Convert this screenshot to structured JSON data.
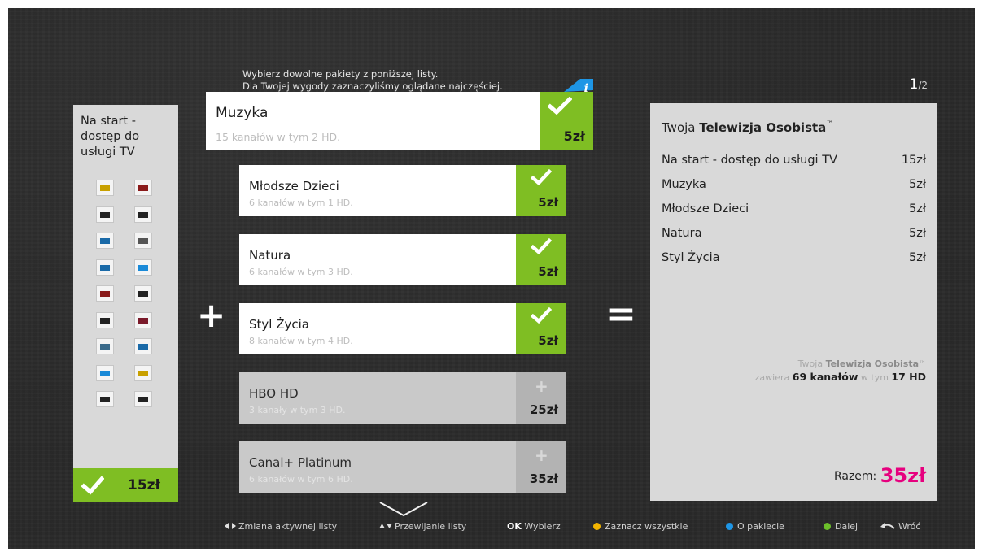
{
  "header": {
    "intro_line1": "Wybierz dowolne pakiety z poniższej listy.",
    "intro_line2": "Dla Twojej wygody zaznaczyliśmy oglądane najczęściej.",
    "page_current": "1",
    "page_total": "/2"
  },
  "base": {
    "title": "Na start - dostęp do usługi TV",
    "price": "15zł",
    "channel_logos": [
      {
        "color": "#c8a000"
      },
      {
        "color": "#8a1a1a"
      },
      {
        "color": "#222222"
      },
      {
        "color": "#222222"
      },
      {
        "color": "#1a6aa8"
      },
      {
        "color": "#555555"
      },
      {
        "color": "#1a6aa8"
      },
      {
        "color": "#1a8ad8"
      },
      {
        "color": "#8a1a1a"
      },
      {
        "color": "#222222"
      },
      {
        "color": "#222222"
      },
      {
        "color": "#7a1a2a"
      },
      {
        "color": "#3a6a8a"
      },
      {
        "color": "#1a6aa8"
      },
      {
        "color": "#1a8ad8"
      },
      {
        "color": "#c8a000"
      },
      {
        "color": "#222222"
      },
      {
        "color": "#222222"
      }
    ]
  },
  "packages": [
    {
      "name": "Muzyka",
      "sub": "15 kanałów w tym 2 HD.",
      "price": "5zł",
      "selected": true
    },
    {
      "name": "Młodsze Dzieci",
      "sub": "6 kanałów w tym 1 HD.",
      "price": "5zł",
      "selected": true
    },
    {
      "name": "Natura",
      "sub": "6 kanałów w tym 3 HD.",
      "price": "5zł",
      "selected": true
    },
    {
      "name": "Styl Życia",
      "sub": "8 kanałów w tym 4 HD.",
      "price": "5zł",
      "selected": true
    },
    {
      "name": "HBO HD",
      "sub": "3 kanały w tym 3 HD.",
      "price": "25zł",
      "selected": false
    },
    {
      "name": "Canal+ Platinum",
      "sub": "6 kanałów w tym 6 HD.",
      "price": "35zł",
      "selected": false
    }
  ],
  "summary": {
    "title_prefix": "Twoja ",
    "title_bold": "Telewizja Osobista",
    "tm": "™",
    "rows": [
      {
        "label": "Na start - dostęp do usługi TV",
        "price": "15zł"
      },
      {
        "label": "Muzyka",
        "price": "5zł"
      },
      {
        "label": "Młodsze Dzieci",
        "price": "5zł"
      },
      {
        "label": "Natura",
        "price": "5zł"
      },
      {
        "label": "Styl Życia",
        "price": "5zł"
      }
    ],
    "note_prefix": "Twoja ",
    "note_bold": "Telewizja Osobista",
    "note_tm": "™",
    "note_contains": "zawiera ",
    "channels": "69 kanałów",
    "note_in": " w tym ",
    "hd": "17 HD",
    "total_label": "Razem: ",
    "total_value": "35zł"
  },
  "hints": {
    "switch_list": "Zmiana aktywnej listy",
    "scroll_list": "Przewijanie listy",
    "ok_key": "OK",
    "ok_label": "Wybierz",
    "select_all": "Zaznacz wszystkie",
    "about": "O pakiecie",
    "next": "Dalej",
    "back": "Wróć"
  },
  "colors": {
    "selected_green": "#7fbe23",
    "yellow": "#f2b400",
    "blue": "#1e96e6",
    "green": "#6cbf2a",
    "total_pink": "#e6007e",
    "info_blue": "#1e96e6"
  }
}
